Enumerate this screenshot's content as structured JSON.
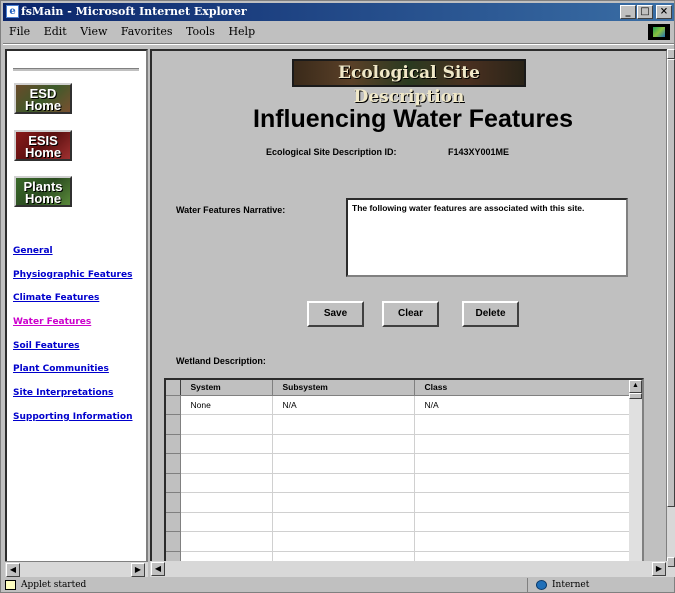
{
  "window": {
    "title": "fsMain - Microsoft Internet Explorer",
    "buttons": {
      "minimize": "_",
      "maximize": "□",
      "close": "×"
    }
  },
  "menubar": {
    "items": [
      "File",
      "Edit",
      "View",
      "Favorites",
      "Tools",
      "Help"
    ]
  },
  "left_nav": {
    "home_buttons": [
      {
        "label": "ESD\nHome"
      },
      {
        "label": "ESIS\nHome"
      },
      {
        "label": "Plants\nHome"
      }
    ],
    "links": [
      "General",
      "Physiographic Features",
      "Climate Features",
      "Water Features",
      "Soil Features",
      "Plant Communities",
      "Site Interpretations",
      "Supporting Information"
    ],
    "active_link": "Water Features"
  },
  "main": {
    "banner": "Ecological Site Description",
    "heading": "Influencing Water Features",
    "id_label": "Ecological Site Description ID:",
    "id_value": "F143XY001ME",
    "narrative_label": "Water Features Narrative:",
    "narrative_text": "The following water features are associated with this site.",
    "buttons": {
      "save": "Save",
      "clear": "Clear",
      "delete": "Delete"
    },
    "wetland_label": "Wetland Description:",
    "grid": {
      "columns": [
        "System",
        "Subsystem",
        "Class"
      ],
      "rows": [
        [
          "None",
          "N/A",
          "N/A"
        ]
      ],
      "empty_rows": 8
    }
  },
  "statusbar": {
    "text": "Applet started",
    "zone": "Internet"
  }
}
